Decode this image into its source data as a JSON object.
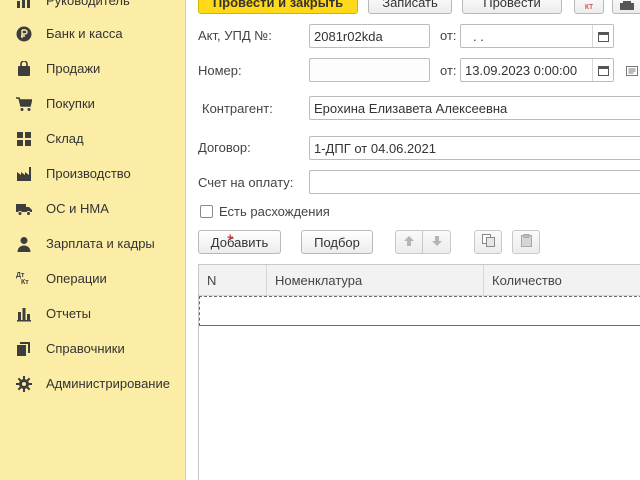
{
  "sidebar": {
    "items": [
      {
        "label": "Руководитель",
        "icon": "chart-icon"
      },
      {
        "label": "Банк и касса",
        "icon": "ruble-icon"
      },
      {
        "label": "Продажи",
        "icon": "bag-icon"
      },
      {
        "label": "Покупки",
        "icon": "cart-icon"
      },
      {
        "label": "Склад",
        "icon": "warehouse-icon"
      },
      {
        "label": "Производство",
        "icon": "factory-icon"
      },
      {
        "label": "ОС и НМА",
        "icon": "truck-icon"
      },
      {
        "label": "Зарплата и кадры",
        "icon": "person-icon"
      },
      {
        "label": "Операции",
        "icon": "dt-kt-icon",
        "icon_text_top": "Дт",
        "icon_text_bottom": "Кт"
      },
      {
        "label": "Отчеты",
        "icon": "bar-chart-icon"
      },
      {
        "label": "Справочники",
        "icon": "books-icon"
      },
      {
        "label": "Администрирование",
        "icon": "gear-icon"
      }
    ]
  },
  "toolbar": {
    "post_close_label": "Провести и закрыть",
    "save_label": "Записать",
    "post_label": "Провести",
    "dtkt_label": "кт"
  },
  "form": {
    "act_label": "Акт, УПД №:",
    "act_value": "2081r02kda",
    "from_label_1": "от:",
    "act_date": " .  .",
    "number_label": "Номер:",
    "number_value": "",
    "from_label_2": "от:",
    "number_date": "13.09.2023  0:00:00",
    "counterparty_label": "Контрагент:",
    "counterparty_value": "Ерохина Елизавета Алексеевна",
    "contract_label": "Договор:",
    "contract_value": "1-ДПГ от 04.06.2021",
    "invoice_label": "Счет на оплату:",
    "invoice_value": "",
    "discrepancy_label": "Есть расхождения",
    "discrepancy_checked": false
  },
  "table_toolbar": {
    "add_label": "Добавить",
    "select_label": "Подбор"
  },
  "table": {
    "columns": [
      "N",
      "Номенклатура",
      "Количество"
    ]
  },
  "colors": {
    "sidebar_bg": "#fbeda5",
    "primary_button": "#ffd91a"
  }
}
